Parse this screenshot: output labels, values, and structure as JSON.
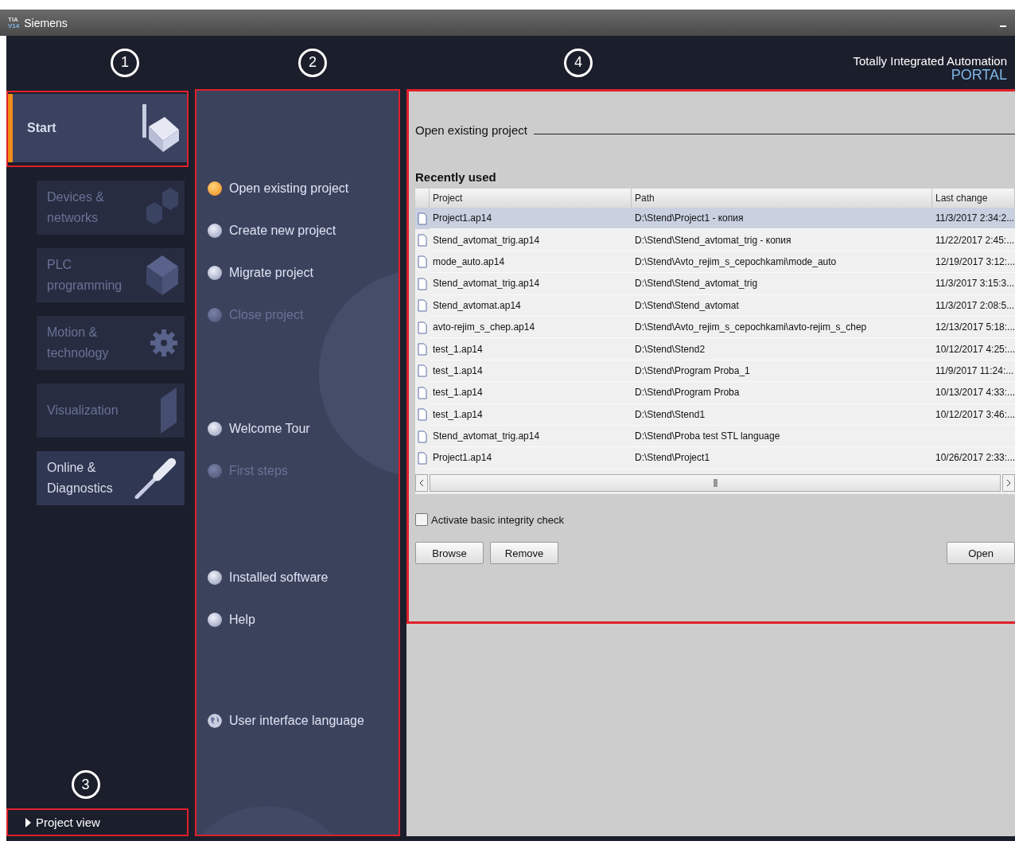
{
  "window": {
    "app_icon": [
      "TIA",
      "V14"
    ],
    "title": "Siemens"
  },
  "callouts": [
    "1",
    "2",
    "3",
    "4"
  ],
  "brand": {
    "line_1": "Totally Integrated Automation",
    "line_2": "PORTAL"
  },
  "nav": [
    {
      "label": "Start",
      "selected": true,
      "disabled": false
    },
    {
      "label": "Devices & networks",
      "selected": false,
      "disabled": true
    },
    {
      "label": "PLC programming",
      "selected": false,
      "disabled": true
    },
    {
      "label": "Motion & technology",
      "selected": false,
      "disabled": true
    },
    {
      "label": "Visualization",
      "selected": false,
      "disabled": true
    },
    {
      "label": "Online & Diagnostics",
      "selected": false,
      "disabled": false
    }
  ],
  "actions": [
    [
      {
        "label": "Open existing project",
        "selected": true,
        "disabled": false
      },
      {
        "label": "Create new project",
        "selected": false,
        "disabled": false
      },
      {
        "label": "Migrate project",
        "selected": false,
        "disabled": false
      },
      {
        "label": "Close project",
        "selected": false,
        "disabled": true
      }
    ],
    [
      {
        "label": "Welcome Tour",
        "selected": false,
        "disabled": false
      },
      {
        "label": "First steps",
        "selected": false,
        "disabled": true
      }
    ],
    [
      {
        "label": "Installed software",
        "selected": false,
        "disabled": false
      },
      {
        "label": "Help",
        "selected": false,
        "disabled": false
      }
    ],
    [
      {
        "label": "User interface language",
        "selected": false,
        "disabled": false,
        "kind": "globe"
      }
    ]
  ],
  "content": {
    "heading": "Open existing project",
    "recent_title": "Recently used",
    "columns": [
      "Project",
      "Path",
      "Last change"
    ],
    "rows": [
      {
        "project": "Project1.ap14",
        "path": "D:\\Stend\\Project1 - копия",
        "last_change": "11/3/2017 2:34:2...",
        "selected": true
      },
      {
        "project": "Stend_avtomat_trig.ap14",
        "path": "D:\\Stend\\Stend_avtomat_trig - копия",
        "last_change": "11/22/2017 2:45:...",
        "selected": false
      },
      {
        "project": "mode_auto.ap14",
        "path": "D:\\Stend\\Avto_rejim_s_cepochkami\\mode_auto",
        "last_change": "12/19/2017 3:12:...",
        "selected": false
      },
      {
        "project": "Stend_avtomat_trig.ap14",
        "path": "D:\\Stend\\Stend_avtomat_trig",
        "last_change": "11/3/2017 3:15:3...",
        "selected": false
      },
      {
        "project": "Stend_avtomat.ap14",
        "path": "D:\\Stend\\Stend_avtomat",
        "last_change": "11/3/2017 2:08:5...",
        "selected": false
      },
      {
        "project": "avto-rejim_s_chep.ap14",
        "path": "D:\\Stend\\Avto_rejim_s_cepochkami\\avto-rejim_s_chep",
        "last_change": "12/13/2017 5:18:...",
        "selected": false
      },
      {
        "project": "test_1.ap14",
        "path": "D:\\Stend\\Stend2",
        "last_change": "10/12/2017 4:25:...",
        "selected": false
      },
      {
        "project": "test_1.ap14",
        "path": "D:\\Stend\\Program Proba_1",
        "last_change": "11/9/2017 11:24:...",
        "selected": false
      },
      {
        "project": "test_1.ap14",
        "path": "D:\\Stend\\Program Proba",
        "last_change": "10/13/2017 4:33:...",
        "selected": false
      },
      {
        "project": "test_1.ap14",
        "path": "D:\\Stend\\Stend1",
        "last_change": "10/12/2017 3:46:...",
        "selected": false
      },
      {
        "project": "Stend_avtomat_trig.ap14",
        "path": "D:\\Stend\\Proba test STL language",
        "selected": false
      },
      {
        "project": "Project1.ap14",
        "path": "D:\\Stend\\Project1",
        "last_change": "10/26/2017 2:33:...",
        "selected": false
      }
    ],
    "integrity_check": {
      "label": "Activate basic integrity check",
      "checked": false
    },
    "buttons": [
      "Browse",
      "Remove",
      "Open"
    ]
  },
  "footer": {
    "project_view": "Project view"
  }
}
